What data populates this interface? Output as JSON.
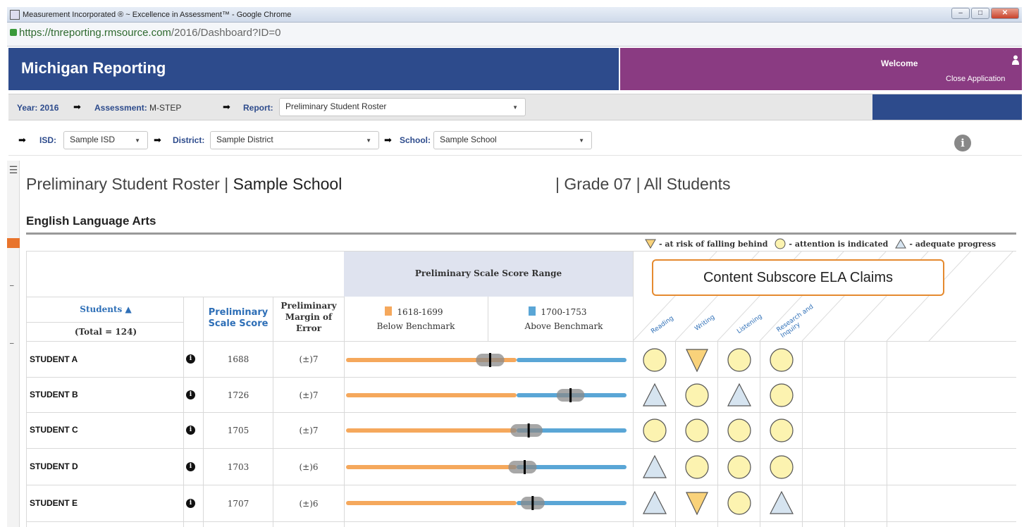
{
  "browser": {
    "window_title": "Measurement Incorporated ® ~ Excellence in Assessment™ - Google Chrome",
    "url_host": "https://tnreporting.rmsource.com",
    "url_path": "/2016/Dashboard?ID=0"
  },
  "header": {
    "brand": "Michigan Reporting",
    "welcome": "Welcome",
    "close_application": "Close Application"
  },
  "filters": {
    "year_label": "Year:",
    "year_value": "2016",
    "assessment_label": "Assessment:",
    "assessment_value": "M-STEP",
    "report_label": "Report:",
    "report_value": "Preliminary Student Roster",
    "isd_label": "ISD:",
    "isd_value": "Sample ISD",
    "district_label": "District:",
    "district_value": "Sample District",
    "school_label": "School:",
    "school_value": "Sample School"
  },
  "page": {
    "title": "Preliminary Student Roster",
    "school": "Sample School",
    "grade": "Grade 07",
    "population": "All Students",
    "sep": "|",
    "subject": "English Language Arts"
  },
  "legend": {
    "risk": "- at risk of falling behind",
    "attention": "- attention is indicated",
    "adequate": "- adequate progress"
  },
  "table": {
    "students_header": "Students ▲",
    "total": "(Total = 124)",
    "scale_score_header": "Preliminary Scale Score",
    "moe_header": "Preliminary Margin of Error",
    "range_header": "Preliminary Scale Score Range",
    "below_range": "1618-1699",
    "below_label": "Below Benchmark",
    "above_range": "1700-1753",
    "above_label": "Above Benchmark",
    "callout": "Content Subscore ELA Claims",
    "claims": [
      "Reading",
      "Writing",
      "Listening",
      "Research and Inquiry"
    ],
    "range_min": 1618,
    "range_cut": 1700,
    "range_max": 1753,
    "rows": [
      {
        "name": "STUDENT A",
        "score": "1688",
        "moe": "(±)7",
        "score_value": 1688,
        "claims": [
          "circle",
          "down",
          "circle",
          "circle"
        ]
      },
      {
        "name": "STUDENT B",
        "score": "1726",
        "moe": "(±)7",
        "score_value": 1726,
        "claims": [
          "up",
          "circle",
          "up",
          "circle"
        ]
      },
      {
        "name": "STUDENT C",
        "score": "1705",
        "moe": "(±)7",
        "score_value": 1705,
        "claims": [
          "circle",
          "circle",
          "circle",
          "circle"
        ]
      },
      {
        "name": "STUDENT D",
        "score": "1703",
        "moe": "(±)6",
        "score_value": 1703,
        "claims": [
          "up",
          "circle",
          "circle",
          "circle"
        ]
      },
      {
        "name": "STUDENT E",
        "score": "1707",
        "moe": "(±)6",
        "score_value": 1707,
        "claims": [
          "up",
          "down",
          "circle",
          "up"
        ]
      }
    ]
  },
  "colors": {
    "navy": "#2d4b8c",
    "purple": "#8a3b82",
    "below": "#f5a85c",
    "above": "#5aa6d6",
    "risk": "#f9d27a",
    "attention": "#fcf3b0",
    "adequate": "#d6e4f0"
  }
}
